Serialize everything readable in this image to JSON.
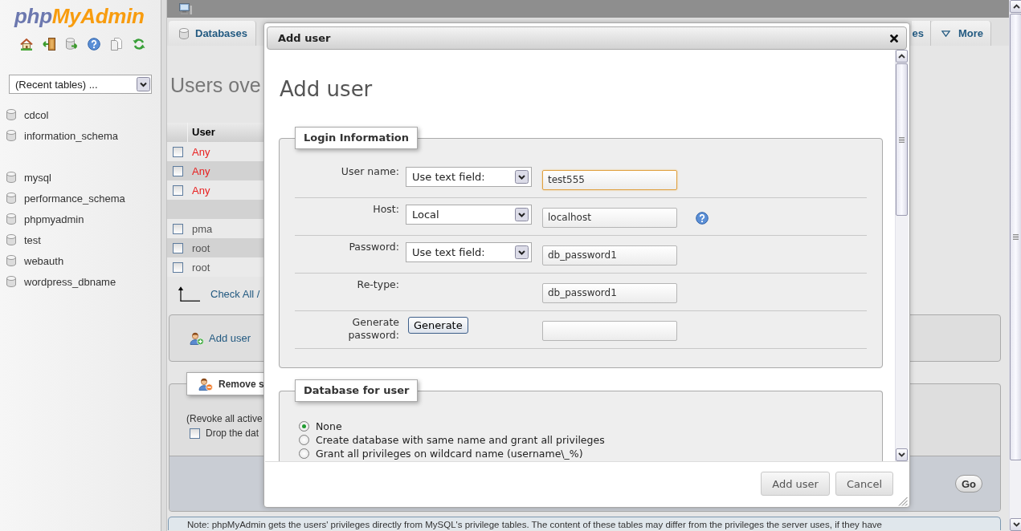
{
  "sidebar": {
    "logo": {
      "prefix": "php",
      "name": "MyAdmin"
    },
    "recent_tables": {
      "value": "(Recent tables) ..."
    },
    "database_groups": [
      {
        "databases": [
          "cdcol",
          "information_schema"
        ]
      },
      {
        "databases": [
          "mysql",
          "performance_schema",
          "phpmyadmin",
          "test",
          "webauth",
          "wordpress_dbname"
        ]
      }
    ]
  },
  "tabs": [
    {
      "label": "Databases",
      "kind": "database",
      "selected": false
    },
    {
      "label": "es",
      "kind": "plain",
      "selected": false
    },
    {
      "label": "More",
      "kind": "menu",
      "selected": false
    }
  ],
  "page_heading": "Users ove",
  "users_table": {
    "columns": [
      "User"
    ],
    "rows": [
      {
        "kind": "anonymous",
        "user": "Any",
        "checked": false
      },
      {
        "kind": "anonymous",
        "user": "Any",
        "checked": false
      },
      {
        "kind": "anonymous",
        "user": "Any",
        "checked": false
      },
      {
        "kind": "blank"
      },
      {
        "kind": "user",
        "user": "pma",
        "checked": false
      },
      {
        "kind": "user",
        "user": "root",
        "checked": false
      },
      {
        "kind": "user",
        "user": "root",
        "checked": false
      }
    ]
  },
  "check_all": "Check All /",
  "add_user_panel": {
    "link": "Add user"
  },
  "remove_panel": {
    "legend": "Remove s",
    "hint": "(Revoke all active",
    "drop_database": {
      "label": "Drop the dat",
      "checked": false
    },
    "go_button": "Go"
  },
  "notice": "Note: phpMyAdmin gets the users' privileges directly from MySQL's privilege tables. The content of these tables may differ from the privileges the server uses, if they have",
  "dialog": {
    "title": "Add user",
    "heading": "Add user",
    "login": {
      "legend": "Login Information",
      "rows": [
        {
          "kind": "select_input",
          "label": "User name:",
          "select": "Use text field:",
          "value": "test555",
          "focused": true,
          "help": false
        },
        {
          "kind": "select_input",
          "label": "Host:",
          "select": "Local",
          "value": "localhost",
          "focused": false,
          "help": true
        },
        {
          "kind": "select_input",
          "label": "Password:",
          "select": "Use text field:",
          "value": "db_password1",
          "focused": false,
          "help": false
        },
        {
          "kind": "input",
          "label": "Re-type:",
          "value": "db_password1",
          "focused": false,
          "help": false
        },
        {
          "kind": "generate",
          "label": "Generate password:",
          "button": "Generate",
          "focused": false,
          "help": false
        }
      ]
    },
    "database": {
      "legend": "Database for user",
      "options": [
        {
          "label": "None",
          "selected": true
        },
        {
          "label": "Create database with same name and grant all privileges",
          "selected": false
        },
        {
          "label": "Grant all privileges on wildcard name (username\\_%)",
          "selected": false
        }
      ]
    },
    "buttons": [
      "Add user",
      "Cancel"
    ]
  }
}
